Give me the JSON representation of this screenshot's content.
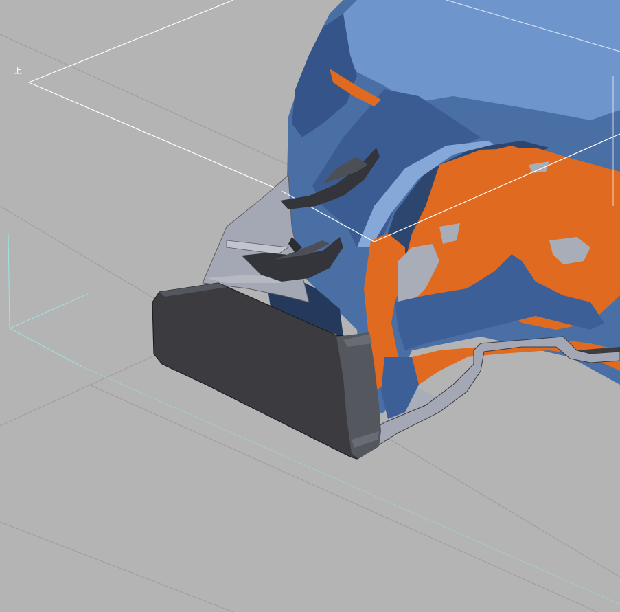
{
  "viewport": {
    "background": "#b4b4b4",
    "plane_label": "上"
  },
  "colors": {
    "grid": "#9c9c9c",
    "construction_plane": "#ffffff",
    "axis": "#9fe3e3",
    "scan_blue": "#4a6fa5",
    "scan_blue_dark": "#2c4670",
    "scan_orange": "#e06a1f",
    "cad_dark": "#3b3b40",
    "cad_light": "#a4a8b4"
  },
  "icons": [
    "plane-label-glyph"
  ]
}
